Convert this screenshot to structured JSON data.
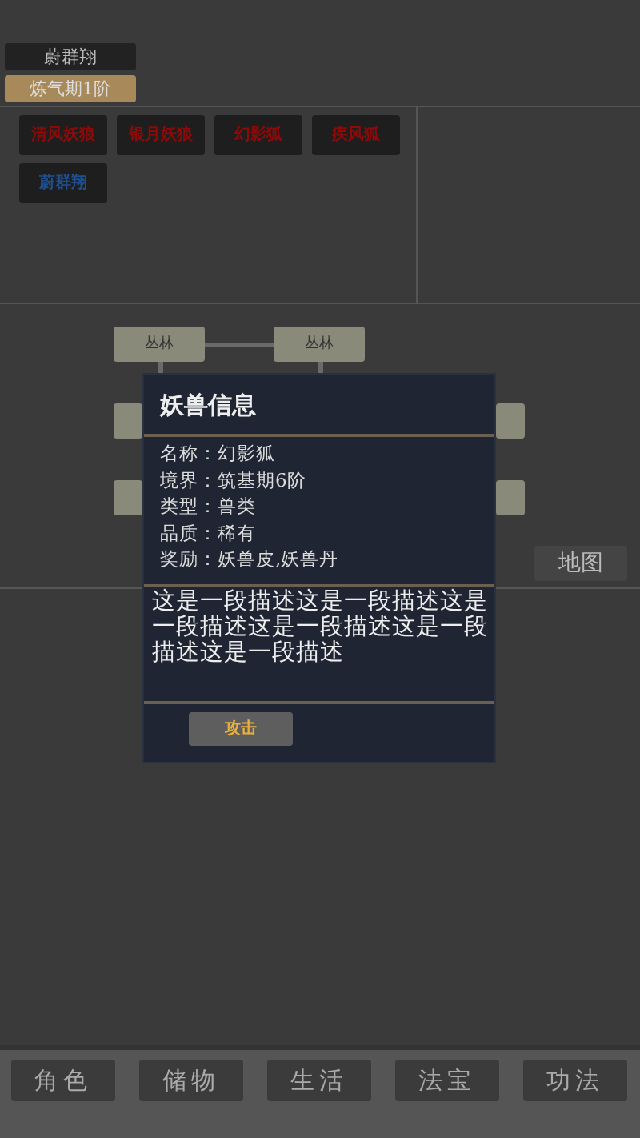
{
  "player": {
    "name": "蔚群翔",
    "realm": "炼气期1阶"
  },
  "monsters": [
    {
      "name": "清风妖狼",
      "color": "#8b0a0a"
    },
    {
      "name": "银月妖狼",
      "color": "#8b0a0a"
    },
    {
      "name": "幻影狐",
      "color": "#8b0a0a"
    },
    {
      "name": "疾风狐",
      "color": "#8b0a0a"
    },
    {
      "name": "蔚群翔",
      "color": "#1f4f8f"
    }
  ],
  "map": {
    "nodes": [
      {
        "label": "丛林"
      },
      {
        "label": "丛林"
      }
    ],
    "map_button": "地图"
  },
  "dialog": {
    "title": "妖兽信息",
    "fields": [
      {
        "label": "名称：",
        "value": "幻影狐"
      },
      {
        "label": "境界：",
        "value": "筑基期6阶"
      },
      {
        "label": "类型：",
        "value": "兽类"
      },
      {
        "label": "品质：",
        "value": "稀有"
      },
      {
        "label": "奖励：",
        "value": "妖兽皮,妖兽丹"
      }
    ],
    "description": "这是一段描述这是一段描述这是一段描述这是一段描述这是一段描述这是一段描述",
    "button": "攻击"
  },
  "nav": [
    {
      "label": "角色"
    },
    {
      "label": "储物"
    },
    {
      "label": "生活"
    },
    {
      "label": "法宝"
    },
    {
      "label": "功法"
    }
  ]
}
